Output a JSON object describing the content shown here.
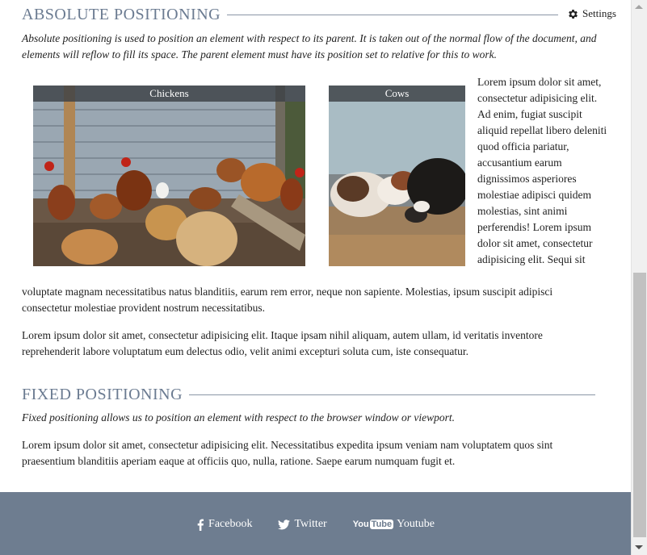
{
  "absolute_section": {
    "heading": "ABSOLUTE POSITIONING",
    "intro": "Absolute positioning is used to position an element with respect to its parent. It is taken out of the normal flow of the document, and elements will reflow to fill its space. The parent element must have its position set to relative for this to work.",
    "figures": [
      {
        "caption": "Chickens"
      },
      {
        "caption": "Cows"
      }
    ],
    "side_text": "Lorem ipsum dolor sit amet, consectetur adipisicing elit. Ad enim, fugiat suscipit aliquid repellat libero deleniti quod officia pariatur, accusantium earum dignissimos asperiores molestiae adipisci quidem molestias, sint animi perferendis! Lorem ipsum dolor sit amet, consectetur adipisicing elit. Sequi sit",
    "wrap_text": "voluptate magnam necessitatibus natus blanditiis, earum rem error, neque non sapiente. Molestias, ipsum suscipit adipisci consectetur molestiae provident nostrum necessitatibus.",
    "paragraph2": "Lorem ipsum dolor sit amet, consectetur adipisicing elit. Itaque ipsam nihil aliquam, autem ullam, id veritatis inventore reprehenderit labore voluptatum eum delectus odio, velit animi excepturi soluta cum, iste consequatur."
  },
  "settings": {
    "label": "Settings",
    "icon": "gear-icon"
  },
  "fixed_section": {
    "heading": "FIXED POSITIONING",
    "intro": "Fixed positioning allows us to position an element with respect to the browser window or viewport.",
    "paragraph": "Lorem ipsum dolor sit amet, consectetur adipisicing elit. Necessitatibus expedita ipsum veniam nam voluptatem quos sint praesentium blanditiis aperiam eaque at officiis quo, nulla, ratione. Saepe earum numquam fugit et."
  },
  "footer": {
    "links": [
      {
        "label": "Facebook",
        "icon": "facebook-icon"
      },
      {
        "label": "Twitter",
        "icon": "twitter-icon"
      },
      {
        "label": "Youtube",
        "icon": "youtube-icon",
        "logo_you": "You",
        "logo_tube": "Tube"
      }
    ]
  },
  "colors": {
    "heading": "#6b7b91",
    "footer_bg": "#6e7d90",
    "caption_bg": "#3c4146"
  }
}
